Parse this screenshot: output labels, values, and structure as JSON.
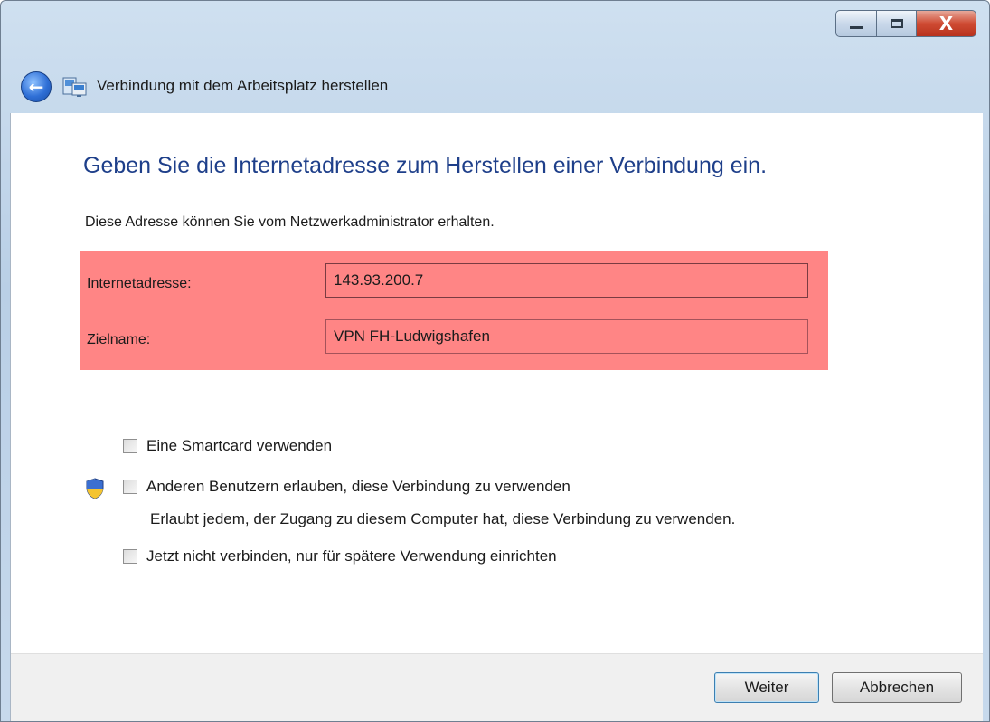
{
  "window": {
    "title": "Verbindung mit dem Arbeitsplatz herstellen",
    "controls": {
      "minimize": "minimize",
      "maximize": "maximize",
      "close": "X"
    }
  },
  "main": {
    "heading": "Geben Sie die Internetadresse zum Herstellen einer Verbindung ein.",
    "description": "Diese Adresse können Sie vom Netzwerkadministrator erhalten.",
    "fields": {
      "address_label": "Internetadresse:",
      "address_value": "143.93.200.7",
      "destination_label": "Zielname:",
      "destination_value": "VPN FH-Ludwigshafen"
    },
    "options": [
      {
        "label": "Eine Smartcard verwenden",
        "checked": false
      },
      {
        "label": "Anderen Benutzern erlauben, diese Verbindung zu verwenden",
        "checked": false,
        "sublabel": "Erlaubt jedem, der Zugang zu diesem Computer hat, diese Verbindung zu verwenden."
      },
      {
        "label": "Jetzt nicht verbinden, nur für spätere Verwendung einrichten",
        "checked": false
      }
    ]
  },
  "footer": {
    "next_label": "Weiter",
    "cancel_label": "Abbrechen"
  },
  "colors": {
    "highlight": "#ff8585",
    "heading": "#1e3f8a"
  },
  "icons": [
    "back-arrow-icon",
    "network-connection-icon",
    "uac-shield-icon",
    "minimize-icon",
    "maximize-icon",
    "close-icon"
  ]
}
